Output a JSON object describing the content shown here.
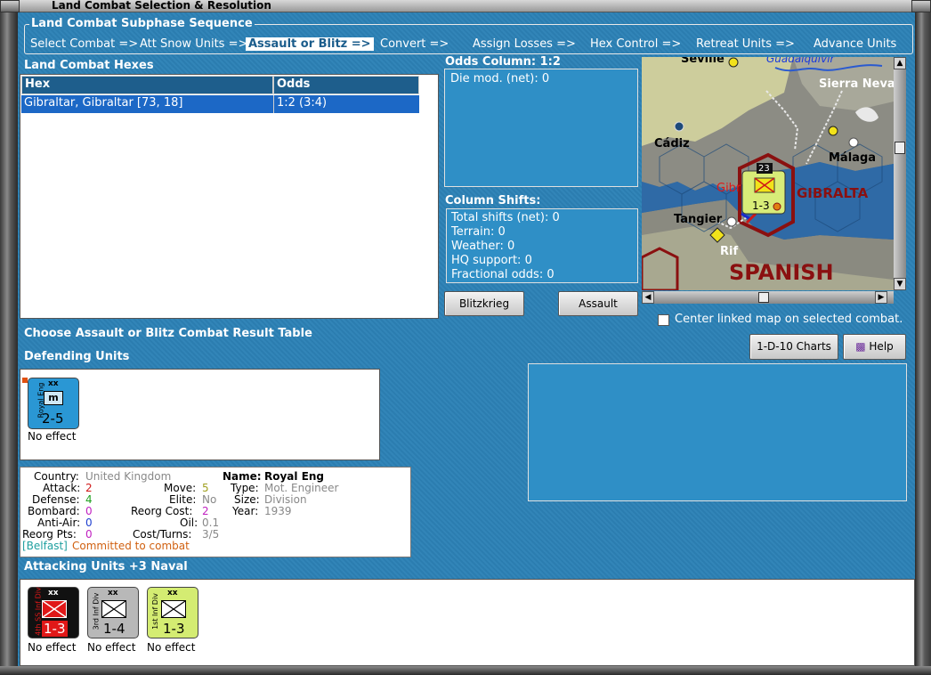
{
  "window": {
    "title": "Land Combat Selection & Resolution"
  },
  "sequence": {
    "title": "Land Combat Subphase Sequence",
    "steps": [
      "Select Combat =>",
      "Att Snow Units =>",
      "Assault or Blitz =>",
      "Convert =>",
      "Assign Losses =>",
      "Hex Control =>",
      "Retreat Units =>",
      "Advance Units"
    ],
    "active_index": 2
  },
  "hexes": {
    "label": "Land Combat Hexes",
    "col_hex": "Hex",
    "col_odds": "Odds",
    "rows": [
      {
        "hex": "Gibraltar, Gibraltar [73, 18]",
        "odds": "1:2 (3:4)"
      }
    ]
  },
  "odds": {
    "label": "Odds Column: 1:2",
    "die_mod": "Die mod. (net): 0"
  },
  "shifts": {
    "label": "Column Shifts:",
    "lines": [
      "Total shifts (net): 0",
      "Terrain: 0",
      "Weather: 0",
      "HQ support: 0",
      "Fractional odds: 0"
    ]
  },
  "buttons": {
    "blitz": "Blitzkrieg",
    "assault": "Assault",
    "charts": "1-D-10 Charts",
    "help": "Help"
  },
  "center_map": {
    "label": "Center linked map on selected combat.",
    "checked": false
  },
  "crt_label": "Choose Assault or Blitz Combat Result Table",
  "defending": {
    "label": "Defending Units",
    "units": [
      {
        "side": "Royal Eng",
        "size": "xx",
        "str": "2-5",
        "result": "No effect",
        "color": "#2a97d4"
      }
    ]
  },
  "unit_info": {
    "country_k": "Country:",
    "country": "United Kingdom",
    "attack_k": "Attack:",
    "attack": "2",
    "defense_k": "Defense:",
    "defense": "4",
    "bombard_k": "Bombard:",
    "bombard": "0",
    "antiair_k": "Anti-Air:",
    "antiair": "0",
    "reorgpts_k": "Reorg Pts:",
    "reorgpts": "0",
    "move_k": "Move:",
    "move": "5",
    "elite_k": "Elite:",
    "elite": "No",
    "reorgcost_k": "Reorg Cost:",
    "reorgcost": "2",
    "oil_k": "Oil:",
    "oil": "0.1",
    "costturns_k": "Cost/Turns:",
    "costturns": "3/5",
    "name_k": "Name:",
    "name": "Royal Eng",
    "type_k": "Type:",
    "type": "Mot. Engineer",
    "size_k": "Size:",
    "size": "Division",
    "year_k": "Year:",
    "year": "1939",
    "location": "[Belfast]",
    "status": "Committed to combat"
  },
  "attacking": {
    "label": "Attacking Units +3 Naval",
    "units": [
      {
        "side": "4th SS Inf Div",
        "size": "xx",
        "str": "1-3",
        "result": "No effect",
        "color": "#111111",
        "sym": "#e01818"
      },
      {
        "side": "3rd Inf Div",
        "size": "xx",
        "str": "1-4",
        "result": "No effect",
        "color": "#b8b8b8",
        "sym": "#ffffff"
      },
      {
        "side": "1st Inf Div",
        "size": "xx",
        "str": "1-3",
        "result": "No effect",
        "color": "#d4ec72",
        "sym": "#ffffff"
      }
    ]
  },
  "map": {
    "places": [
      "Seville",
      "Guadalquivir",
      "Sierra Neva",
      "Cádiz",
      "Málaga",
      "Gibr",
      "GIBRALTA",
      "Tangier",
      "Rif",
      "SPANISH"
    ],
    "stack_count": "23",
    "stack_side": "1st Inf Div",
    "stack_str": "1-3"
  }
}
